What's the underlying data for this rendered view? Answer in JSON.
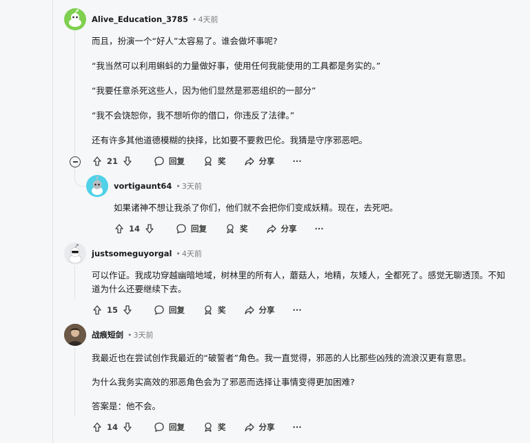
{
  "comments": [
    {
      "author": "Alive_Education_3785",
      "time": "4天前",
      "paragraphs": [
        "而且，扮演一个“好人”太容易了。谁会做坏事呢?",
        "“我当然可以利用蝌蚪的力量做好事，使用任何我能使用的工具都是务实的。”",
        "“我要任意杀死这些人，因为他们显然是邪恶组织的一部分”",
        "“我不会饶恕你，我不想听你的借口，你违反了法律。”",
        "还有许多其他道德模糊的抉择，比如要不要救巴伦。我猜是守序邪恶吧。"
      ],
      "votes": "21",
      "reply_label": "回复",
      "award_label": "奖",
      "share_label": "分享",
      "more_label": "···"
    },
    {
      "author": "vortigaunt64",
      "time": "3天前",
      "paragraphs": [
        "如果诸神不想让我杀了你们，他们就不会把你们变成妖精。现在，去死吧。"
      ],
      "votes": "14",
      "reply_label": "回复",
      "award_label": "奖",
      "share_label": "分享",
      "more_label": "···"
    },
    {
      "author": "justsomeguyorgal",
      "time": "4天前",
      "paragraphs": [
        "可以作证。我成功穿越幽暗地域，树林里的所有人，蘑菇人，地精，灰矮人，全都死了。感觉无聊透顶。不知道为什么还要继续下去。"
      ],
      "votes": "15",
      "reply_label": "回复",
      "award_label": "奖",
      "share_label": "分享",
      "more_label": "···"
    },
    {
      "author": "战痕短剑",
      "time": "3天前",
      "paragraphs": [
        "我最近也在尝试创作我最近的“破誓者”角色。我一直觉得，邪恶的人比那些凶残的流浪汉更有意思。",
        "为什么我务实高效的邪恶角色会为了邪恶而选择让事情变得更加困难?",
        "答案是：他不会。"
      ],
      "votes": "14",
      "reply_label": "回复",
      "award_label": "奖",
      "share_label": "分享",
      "more_label": "···"
    }
  ],
  "separator_dot": "•",
  "colors": {
    "background": "#f6f7f8",
    "thread_line": "#e0e3e6",
    "text": "#1a1a1b",
    "meta": "#7c7c7c",
    "avatar_alive": "#7fd04f",
    "avatar_vortigaunt": "#4fd1e8"
  },
  "icons": {
    "upvote": "arrow-up-icon",
    "downvote": "arrow-down-icon",
    "reply": "speech-bubble-icon",
    "award": "award-icon",
    "share": "share-arrow-icon",
    "collapse": "minus-circle-icon"
  }
}
